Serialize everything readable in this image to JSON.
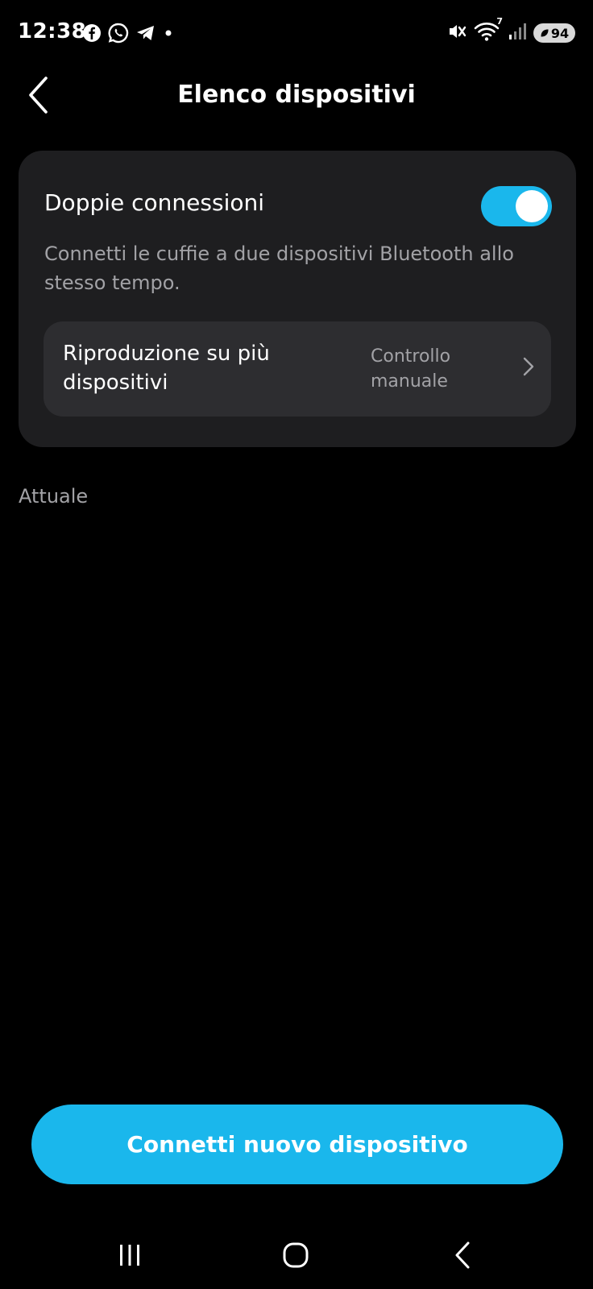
{
  "status_bar": {
    "time": "12:38",
    "left_icons": [
      "facebook-icon",
      "whatsapp-icon",
      "telegram-icon",
      "notification-dot-icon"
    ],
    "right_icons": [
      "mute-vibrate-icon",
      "wifi-icon",
      "signal-icon"
    ],
    "wifi_badge": "7",
    "battery_level": "94"
  },
  "header": {
    "title": "Elenco dispositivi",
    "back_icon": "chevron-left-icon"
  },
  "dual_connection": {
    "title": "Doppie connessioni",
    "toggle_on": true,
    "description": "Connetti le cuffie a due dispositivi Bluetooth allo stesso tempo.",
    "multi_playback": {
      "label": "Riproduzione su più dispositivi",
      "value": "Controllo manuale",
      "icon": "chevron-right-icon"
    }
  },
  "current_section": {
    "label": "Attuale"
  },
  "connect_button": {
    "label": "Connetti nuovo dispositivo"
  },
  "nav_bar": {
    "items": [
      "recents-icon",
      "home-icon",
      "back-icon"
    ]
  },
  "colors": {
    "accent": "#1ab7ec",
    "background": "#000000",
    "card": "#1e1e20",
    "row": "#2d2d30",
    "secondary_text": "#a2a2a6"
  }
}
